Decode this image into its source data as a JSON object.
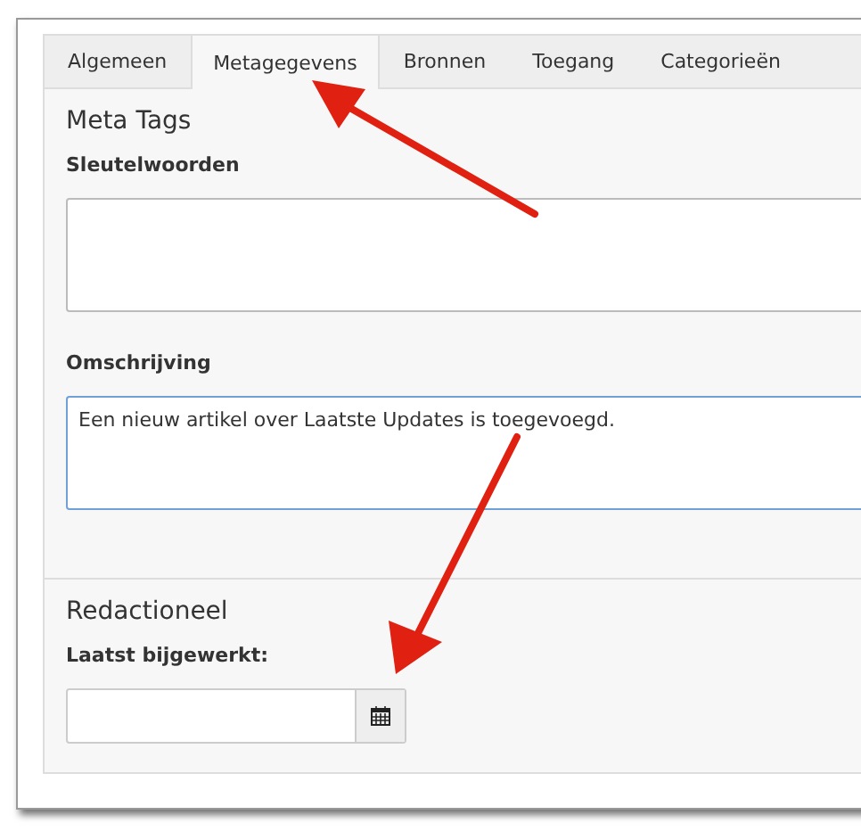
{
  "tabs": [
    {
      "label": "Algemeen",
      "selected": false
    },
    {
      "label": "Metagegevens",
      "selected": true
    },
    {
      "label": "Bronnen",
      "selected": false
    },
    {
      "label": "Toegang",
      "selected": false
    },
    {
      "label": "Categorieën",
      "selected": false
    }
  ],
  "sections": [
    {
      "title": "Meta Tags",
      "fields": [
        {
          "kind": "textarea",
          "label": "Sleutelwoorden",
          "focused": false
        },
        {
          "kind": "textarea",
          "label": "Omschrijving",
          "value": "Een nieuw artikel over Laatste Updates is toegevoegd.",
          "focused": true
        }
      ]
    },
    {
      "title": "Redactioneel",
      "fields": [
        {
          "kind": "date",
          "label": "Laatst bijgewerkt:",
          "focused": false
        }
      ]
    }
  ]
}
